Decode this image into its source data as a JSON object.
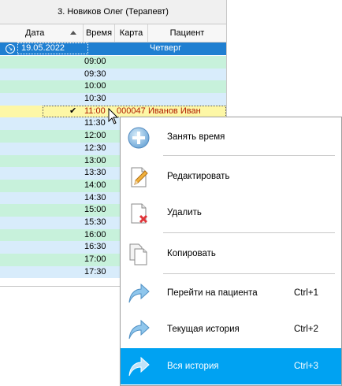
{
  "doctor_header": "3. Новиков Олег (Терапевт)",
  "columns": {
    "date": "Дата",
    "time": "Время",
    "card": "Карта",
    "patient": "Пациент"
  },
  "date_row": {
    "toggle_icon": "collapse-icon",
    "date": "19.05.2022",
    "weekday": "Четверг"
  },
  "slots": [
    {
      "time": "09:00",
      "style": "green"
    },
    {
      "time": "09:30",
      "style": "blue"
    },
    {
      "time": "10:00",
      "style": "green"
    },
    {
      "time": "10:30",
      "style": "blue"
    },
    {
      "time": "11:00",
      "style": "booked",
      "card": "000047",
      "patient": "Иванов Иван",
      "check": "✔"
    },
    {
      "time": "11:30",
      "style": "blue"
    },
    {
      "time": "12:00",
      "style": "green"
    },
    {
      "time": "12:30",
      "style": "blue"
    },
    {
      "time": "13:00",
      "style": "green"
    },
    {
      "time": "13:30",
      "style": "blue"
    },
    {
      "time": "14:00",
      "style": "green"
    },
    {
      "time": "14:30",
      "style": "blue"
    },
    {
      "time": "15:00",
      "style": "green"
    },
    {
      "time": "15:30",
      "style": "blue"
    },
    {
      "time": "16:00",
      "style": "green"
    },
    {
      "time": "16:30",
      "style": "blue"
    },
    {
      "time": "17:00",
      "style": "green"
    },
    {
      "time": "17:30",
      "style": "blue"
    }
  ],
  "menu": {
    "book": "Занять время",
    "edit": "Редактировать",
    "delete": "Удалить",
    "copy": "Копировать",
    "goto_patient": "Перейти на пациента",
    "goto_patient_shortcut": "Ctrl+1",
    "current_history": "Текущая история",
    "current_history_shortcut": "Ctrl+2",
    "full_history": "Вся история",
    "full_history_shortcut": "Ctrl+3"
  },
  "colors": {
    "selection": "#00a2f2",
    "date_row": "#1f7fd1",
    "booked_row": "#fdf7a6",
    "booked_text": "#b01c00"
  }
}
